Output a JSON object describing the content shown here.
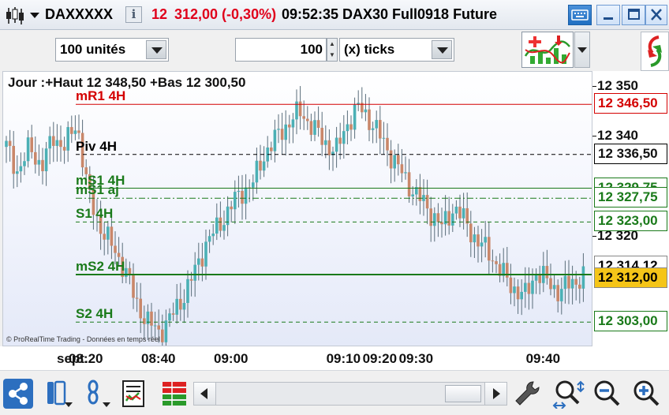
{
  "titlebar": {
    "instrument": "DAXXXXX",
    "price_prefix": "12",
    "price_value": "312,00 (-0,30%)",
    "time": "09:52:35",
    "description": "DAX30 Full0918 Future",
    "info_label": "i",
    "price_color": "#e0001b"
  },
  "toolbar": {
    "units_select": "100 unités",
    "ticks_value": "100",
    "ticks_select": "(x) ticks"
  },
  "chart": {
    "header": "Jour :+Haut 12  348,50 +Bas 12  300,50",
    "copyright": "© ProRealTime Trading - Données en temps réel",
    "levels": [
      {
        "label": "mR1 4H",
        "value": 346.5,
        "price_text": "12  346,50",
        "color": "#d40000",
        "style": "solid"
      },
      {
        "label": "Piv 4H",
        "value": 336.5,
        "price_text": "12  336,50",
        "color": "#000000",
        "style": "dashed"
      },
      {
        "label": "mS1 4H",
        "value": 329.75,
        "price_text": "12  329,75",
        "color": "#1a7a1a",
        "style": "solid"
      },
      {
        "label": "mS1 aj",
        "value": 327.75,
        "price_text": "12  327,75",
        "color": "#1a7a1a",
        "style": "dashdot"
      },
      {
        "label": "S1 4H",
        "value": 323.0,
        "price_text": "12  323,00",
        "color": "#1a7a1a",
        "style": "dashed"
      },
      {
        "label": "mS2 4H",
        "value": 312.5,
        "price_text": "",
        "color": "#1a7a1a",
        "style": "thick"
      },
      {
        "label": "S2 4H",
        "value": 303.0,
        "price_text": "12  303,00",
        "color": "#1a7a1a",
        "style": "dashed"
      }
    ],
    "last_price_text": "12  314,12",
    "current_price_text": "12  312,00",
    "current_price_bg": "#f5c518",
    "price_ticks": [
      {
        "text": "12  350",
        "value": 350
      },
      {
        "text": "12  340",
        "value": 340
      },
      {
        "text": "12  320",
        "value": 320
      }
    ],
    "time_labels": [
      {
        "text": "sept.",
        "bar": 0
      },
      {
        "text": "08:20",
        "bar": 20
      },
      {
        "text": "08:40",
        "bar": 40
      },
      {
        "text": "09:00",
        "bar": 60
      },
      {
        "text": "09:10",
        "bar": 91
      },
      {
        "text": "09:20",
        "bar": 101
      },
      {
        "text": "09:30",
        "bar": 111
      },
      {
        "text": "09:40",
        "bar": 146
      }
    ],
    "up_color": "#4bb0b5",
    "down_color": "#c9876a"
  },
  "chart_data": {
    "type": "candlestick",
    "title": "Jour :+Haut 12  348,50 +Bas 12  300,50",
    "ylim": [
      12298,
      12353
    ],
    "close_path": [
      12338,
      12333,
      12338,
      12334,
      12340,
      12338,
      12343,
      12328,
      12322,
      12318,
      12314,
      12307,
      12303,
      12301,
      12304,
      12308,
      12313,
      12319,
      12322,
      12326,
      12329,
      12331,
      12337,
      12340,
      12343,
      12345,
      12342,
      12339,
      12337,
      12343,
      12346,
      12343,
      12339,
      12335,
      12331,
      12328,
      12325,
      12322,
      12326,
      12323,
      12319,
      12317,
      12313,
      12310,
      12308,
      12313,
      12311,
      12309,
      12311,
      12312
    ]
  }
}
